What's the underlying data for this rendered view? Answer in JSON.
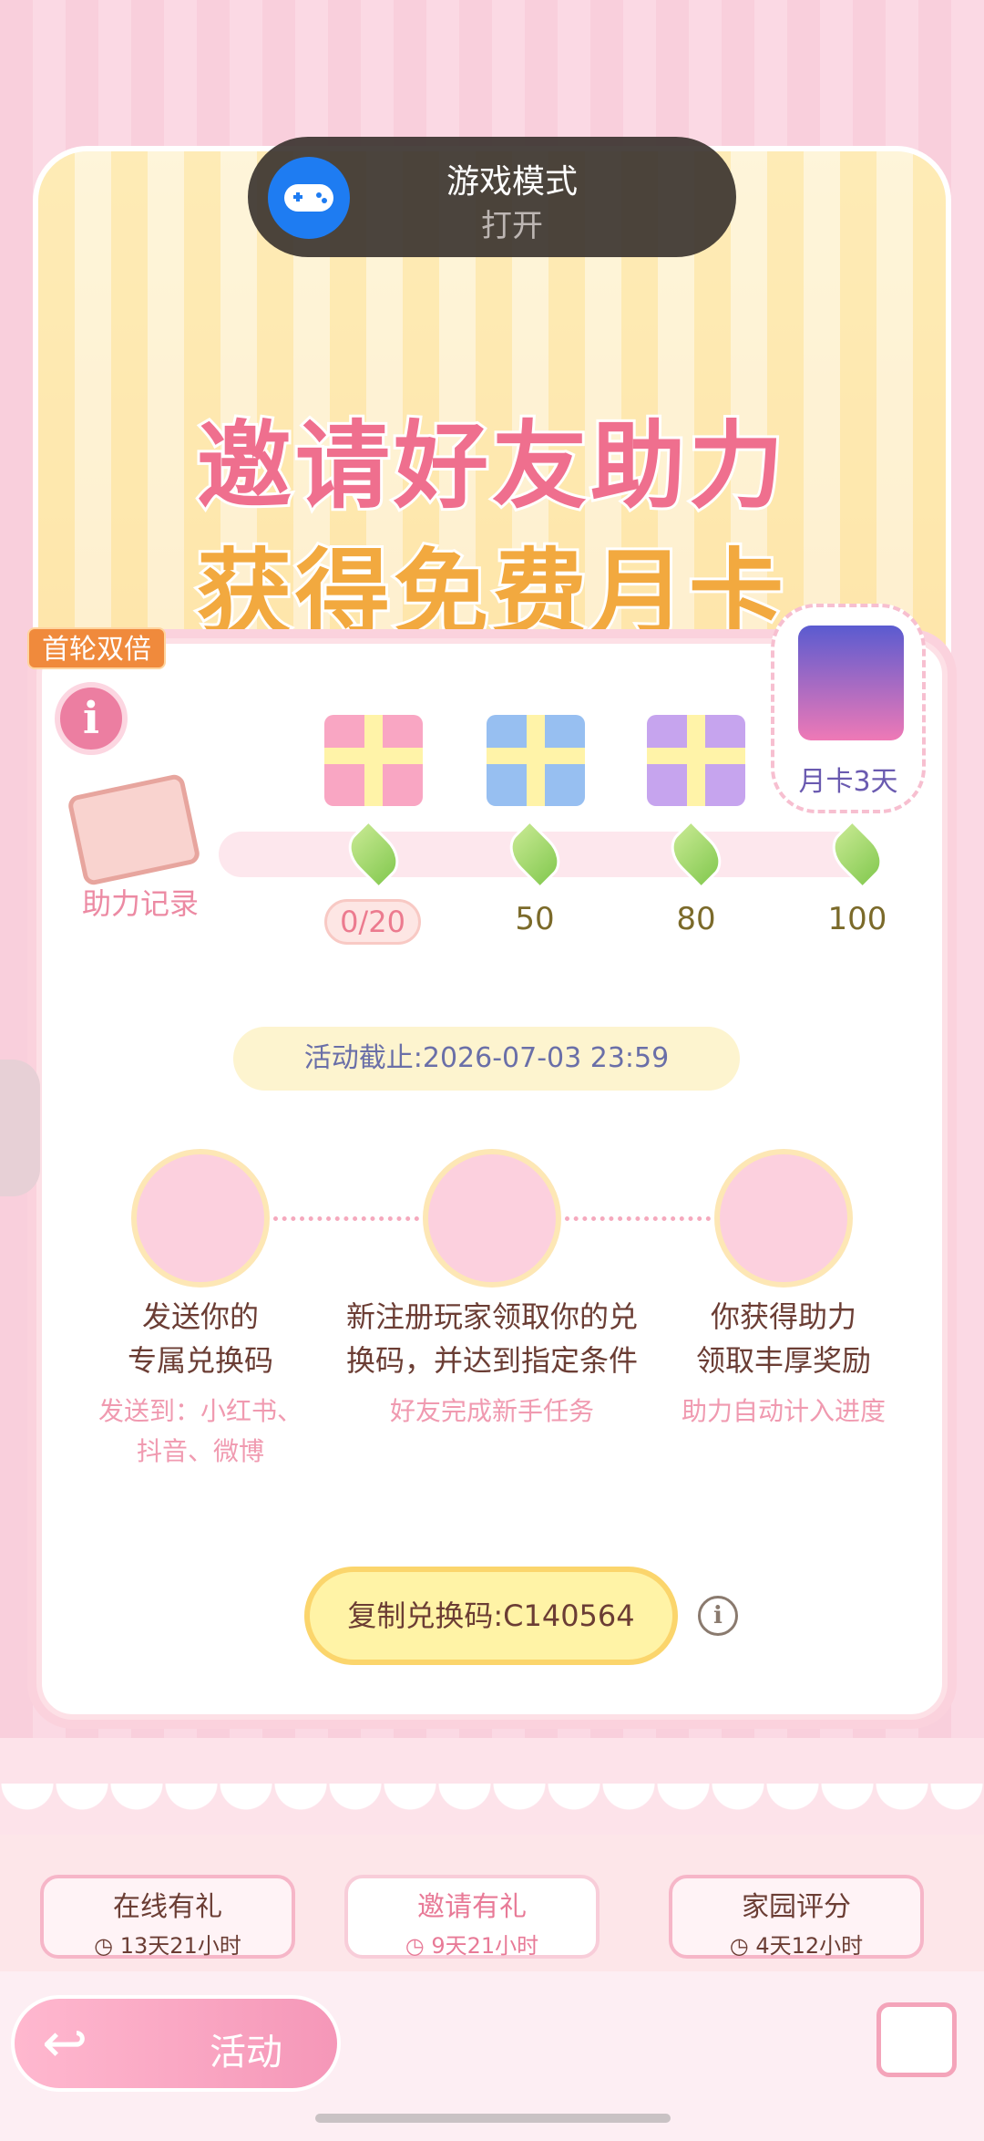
{
  "toast": {
    "title": "游戏模式",
    "status": "打开"
  },
  "banner": {
    "title_line1": "邀请好友助力",
    "title_line2": "获得免费月卡"
  },
  "badge": "首轮双倍",
  "record": {
    "label": "助力记录"
  },
  "progress": {
    "current": "0/20",
    "milestones": [
      "50",
      "80",
      "100"
    ],
    "final_reward_label": "月卡3天"
  },
  "deadline": "活动截止:2026-07-03 23:59",
  "steps": [
    {
      "title_line1": "发送你的",
      "title_line2": "专属兑换码",
      "sub_line1": "发送到：小红书、",
      "sub_line2": "抖音、微博"
    },
    {
      "title_line1": "新注册玩家领取你的兑",
      "title_line2": "换码，并达到指定条件",
      "sub_line1": "好友完成新手任务",
      "sub_line2": ""
    },
    {
      "title_line1": "你获得助力",
      "title_line2": "领取丰厚奖励",
      "sub_line1": "助力自动计入进度",
      "sub_line2": ""
    }
  ],
  "copy_button": "复制兑换码:C140564",
  "tabs": [
    {
      "label": "在线有礼",
      "time": "13天21小时"
    },
    {
      "label": "邀请有礼",
      "time": "9天21小时"
    },
    {
      "label": "家园评分",
      "time": "4天12小时"
    }
  ],
  "bottom": {
    "activity_label": "活动"
  },
  "icons": [
    "gamepad-icon",
    "info-icon",
    "gift-icon",
    "leaf-icon",
    "clock-icon",
    "back-arrow-icon",
    "calendar-icon"
  ],
  "colors": {
    "accent_pink": "#ec7ea1",
    "gold": "#fbd56c",
    "text_brown": "#6b3d34"
  }
}
